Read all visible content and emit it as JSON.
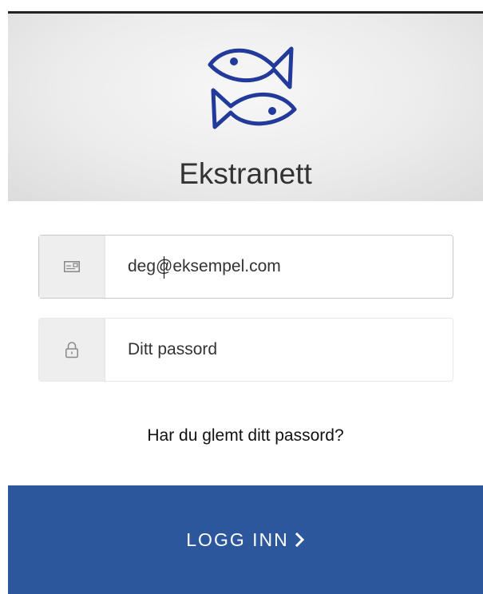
{
  "header": {
    "title": "Ekstranett",
    "logo_icon": "two-fish-logo-icon",
    "logo_color": "#223a9a"
  },
  "email": {
    "icon": "email-card-icon",
    "value": "deg@eksempel.com"
  },
  "password": {
    "icon": "lock-icon",
    "placeholder": "Ditt passord"
  },
  "forgot_label": "Har du glemt ditt passord?",
  "login": {
    "label": "LOGG INN",
    "icon": "chevron-right-icon",
    "color": "#2c579d"
  }
}
